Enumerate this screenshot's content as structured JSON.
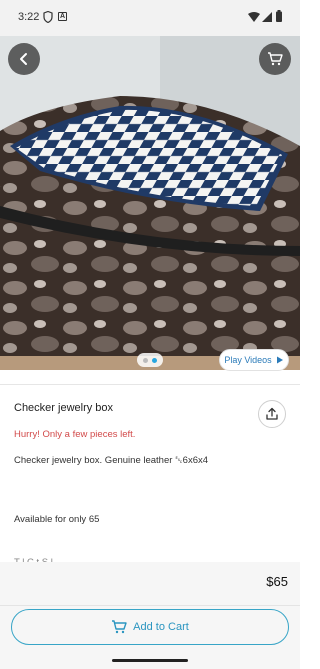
{
  "status_bar": {
    "time": "3:22",
    "letter_icon": "A"
  },
  "hero": {
    "image": "checker-jewelry-box-photo",
    "carousel": {
      "count": 2,
      "active_index": 1
    }
  },
  "header": {
    "back_icon": "chevron-left-icon",
    "cart_icon": "cart-icon"
  },
  "media": {
    "play_videos_label": "Play Videos"
  },
  "product": {
    "title": "Checker jewelry box",
    "stock_warning": "Hurry! Only a few pieces left.",
    "description": "Checker jewelry box. Genuine leather ␛6x6x4",
    "availability": "Available for only 65",
    "partial_text": "T   l   C   t S  l"
  },
  "purchase": {
    "price": "$65",
    "add_to_cart_label": "Add to Cart"
  },
  "colors": {
    "accent": "#2a95c0",
    "warning": "#d24a4a",
    "dot_active": "#29a7e0"
  }
}
